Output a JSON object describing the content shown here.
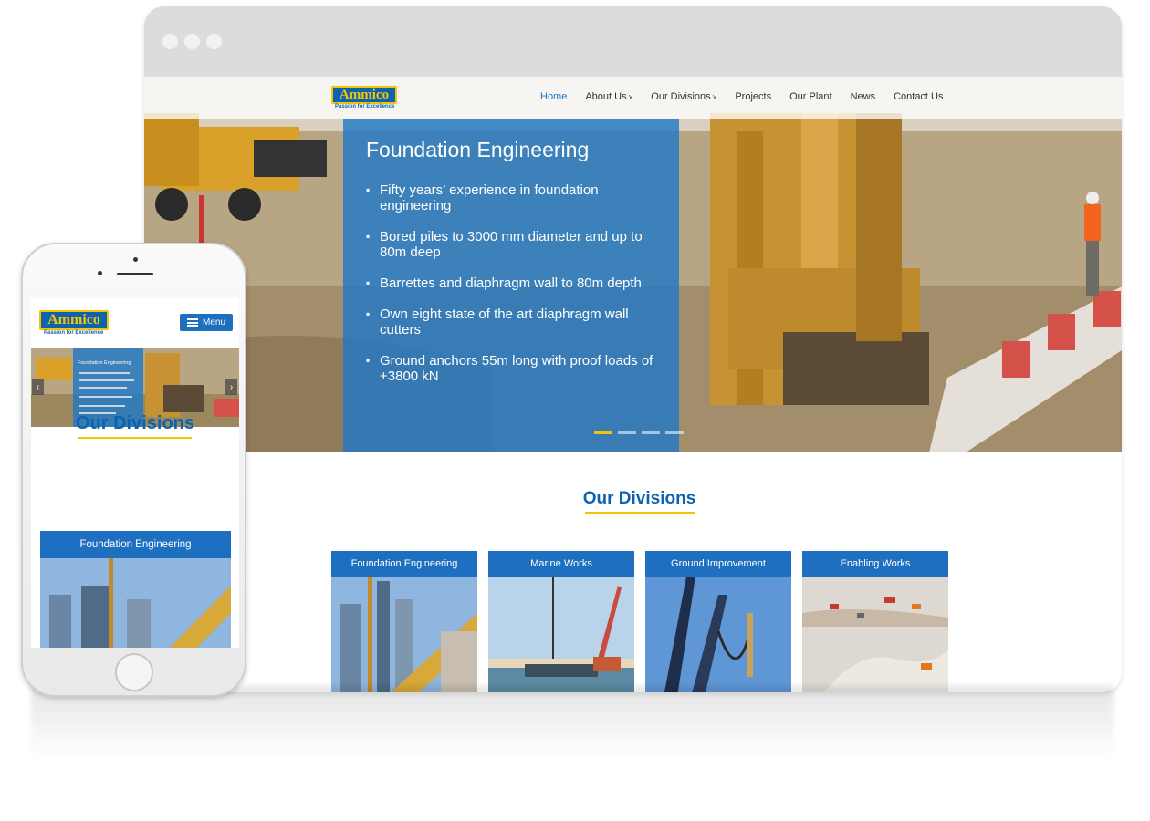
{
  "site": {
    "logo_text": "Ammico",
    "tagline": "Passion for Excellence"
  },
  "nav": {
    "items": [
      {
        "label": "Home",
        "active": true,
        "dropdown": false
      },
      {
        "label": "About Us",
        "active": false,
        "dropdown": true
      },
      {
        "label": "Our Divisions",
        "active": false,
        "dropdown": true
      },
      {
        "label": "Projects",
        "active": false,
        "dropdown": false
      },
      {
        "label": "Our Plant",
        "active": false,
        "dropdown": false
      },
      {
        "label": "News",
        "active": false,
        "dropdown": false
      },
      {
        "label": "Contact Us",
        "active": false,
        "dropdown": false
      }
    ],
    "dropdown_icon": "chevron-down-icon"
  },
  "hero": {
    "title": "Foundation Engineering",
    "bullets": [
      "Fifty years’ experience in foundation engineering",
      "Bored piles to 3000 mm diameter and up to 80m deep",
      "Barrettes and diaphragm wall to 80m depth",
      "Own eight state of the art diaphragm wall cutters",
      "Ground anchors 55m long with proof loads of +3800 kN"
    ],
    "slide_count": 4,
    "active_slide": 1
  },
  "divisions": {
    "title": "Our Divisions",
    "cards": [
      {
        "label": "Foundation Engineering"
      },
      {
        "label": "Marine Works"
      },
      {
        "label": "Ground Improvement"
      },
      {
        "label": "Enabling Works"
      }
    ]
  },
  "mobile": {
    "menu_label": "Menu",
    "hero_title": "Foundation Engineering",
    "divisions_title": "Our Divisions",
    "first_card_label": "Foundation Engineering",
    "prev_arrow": "‹",
    "next_arrow": "›"
  },
  "colors": {
    "brand_blue": "#0d63b0",
    "accent_yellow": "#f4c400",
    "panel_blue": "#1e78c8",
    "nav_active": "#1a78c2"
  }
}
